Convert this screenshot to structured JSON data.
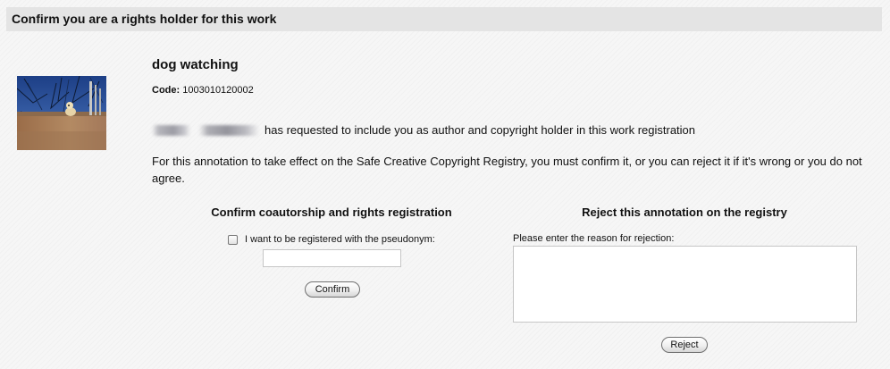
{
  "header": {
    "title": "Confirm you are a rights holder for this work"
  },
  "work": {
    "title": "dog watching",
    "code_label": "Code:",
    "code_value": "1003010120002",
    "request_text": "has requested to include you as author and copyright holder in this work registration",
    "notice": "For this annotation to take effect on the Safe Creative Copyright Registry, you must confirm it, or you can reject it if it's wrong or you do not agree."
  },
  "confirm": {
    "heading": "Confirm coautorship and rights registration",
    "pseudonym_label": "I want to be registered with the pseudonym:",
    "pseudonym_value": "",
    "button_label": "Confirm"
  },
  "reject": {
    "heading": "Reject this annotation on the registry",
    "reason_label": "Please enter the reason for rejection:",
    "reason_value": "",
    "button_label": "Reject"
  },
  "icons": {
    "checkbox": "checkbox-unchecked",
    "thumbnail": "dog-on-rooftop-photo"
  }
}
